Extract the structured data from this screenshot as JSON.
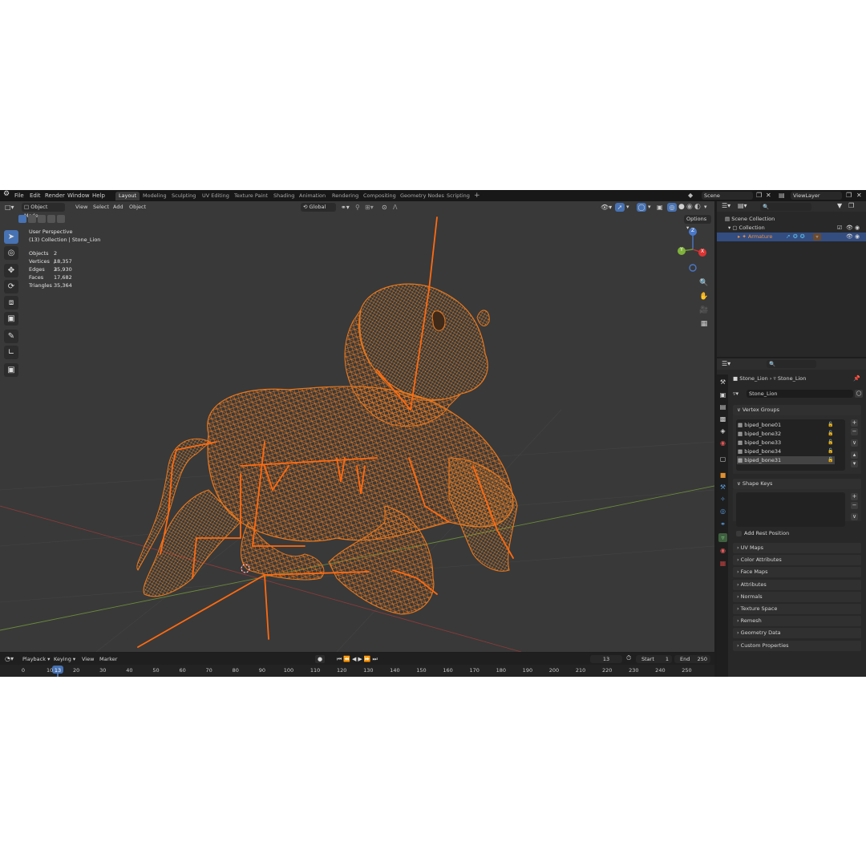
{
  "topbar": {
    "menus": [
      "File",
      "Edit",
      "Render",
      "Window",
      "Help"
    ],
    "workspaces": [
      "Layout",
      "Modeling",
      "Sculpting",
      "UV Editing",
      "Texture Paint",
      "Shading",
      "Animation",
      "Rendering",
      "Compositing",
      "Geometry Nodes",
      "Scripting"
    ],
    "add_tab": "+",
    "scene": "Scene",
    "view_layer": "ViewLayer"
  },
  "viewport_header": {
    "mode": "Object Mode",
    "menus": [
      "View",
      "Select",
      "Add",
      "Object"
    ],
    "orientation": "Global",
    "options": "Options"
  },
  "overlay": {
    "perspective": "User Perspective",
    "collection": "(13) Collection | Stone_Lion",
    "stats": [
      {
        "label": "Objects",
        "value": "2 / 2"
      },
      {
        "label": "Vertices",
        "value": "18,357"
      },
      {
        "label": "Edges",
        "value": "35,930"
      },
      {
        "label": "Faces",
        "value": "17,682"
      },
      {
        "label": "Triangles",
        "value": "35,364"
      }
    ]
  },
  "gizmo": {
    "z": "Z",
    "x": "X",
    "y": "Y"
  },
  "timeline": {
    "menus": [
      "Playback",
      "Keying",
      "View",
      "Marker"
    ],
    "current_frame": "13",
    "start_label": "Start",
    "start": "1",
    "end_label": "End",
    "end": "250",
    "ticks": [
      "0",
      "10",
      "20",
      "30",
      "40",
      "50",
      "60",
      "70",
      "80",
      "90",
      "100",
      "110",
      "120",
      "130",
      "140",
      "150",
      "160",
      "170",
      "180",
      "190",
      "200",
      "210",
      "220",
      "230",
      "240",
      "250"
    ]
  },
  "outliner": {
    "scene_collection": "Scene Collection",
    "collection": "Collection",
    "armature": "Armature"
  },
  "properties": {
    "breadcrumb_object": "Stone_Lion",
    "breadcrumb_mesh": "Stone_Lion",
    "mesh_name": "Stone_Lion",
    "vertex_groups_title": "Vertex Groups",
    "vertex_groups": [
      "biped_bone01",
      "biped_bone32",
      "biped_bone33",
      "biped_bone34",
      "biped_bone31"
    ],
    "shape_keys_title": "Shape Keys",
    "add_rest_position": "Add Rest Position",
    "panels": [
      "UV Maps",
      "Color Attributes",
      "Face Maps",
      "Attributes",
      "Normals",
      "Texture Space",
      "Remesh",
      "Geometry Data",
      "Custom Properties"
    ]
  },
  "colors": {
    "accent": "#4772b3",
    "wire": "#e8781e",
    "bone": "#ff6a10",
    "viewport_bg": "#393939"
  }
}
